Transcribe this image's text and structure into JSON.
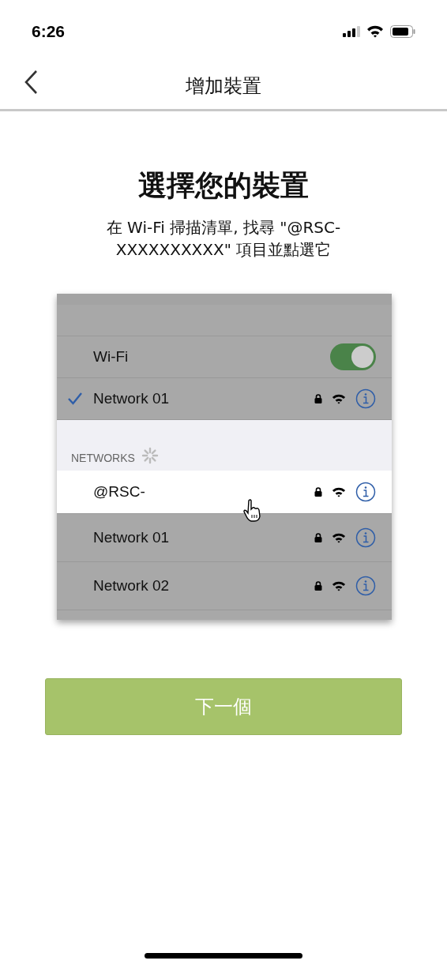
{
  "status_bar": {
    "time": "6:26"
  },
  "header": {
    "title": "增加裝置"
  },
  "heading": "選擇您的裝置",
  "instructions": "在 Wi-Fi 掃描清單, 找尋 \"@RSC-XXXXXXXXXX\" 項目並點選它",
  "illustration": {
    "wifi_label": "Wi-Fi",
    "wifi_on": true,
    "connected": {
      "name": "Network 01",
      "checked": true
    },
    "section_label": "NETWORKS",
    "networks": [
      {
        "name": "@RSC-",
        "highlighted": true
      },
      {
        "name": "Network 01",
        "highlighted": false
      },
      {
        "name": "Network 02",
        "highlighted": false
      }
    ]
  },
  "next_button": "下一個"
}
